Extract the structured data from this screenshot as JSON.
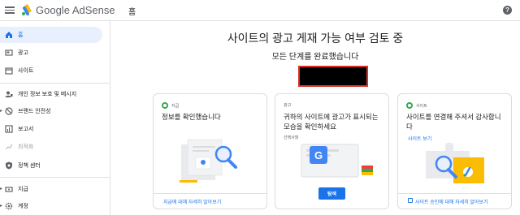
{
  "header": {
    "brand_google": "Google",
    "brand_product": "AdSense",
    "page_title": "홈",
    "help": "?"
  },
  "sidebar": {
    "items": [
      {
        "label": "홈",
        "icon": "home-icon"
      },
      {
        "label": "광고",
        "icon": "ads-icon"
      },
      {
        "label": "사이트",
        "icon": "sites-icon"
      },
      {
        "label": "개인 정보 보호 및 메시지",
        "icon": "privacy-icon"
      },
      {
        "label": "브랜드 안전성",
        "icon": "brand-safety-icon"
      },
      {
        "label": "보고서",
        "icon": "reports-icon"
      },
      {
        "label": "최적화",
        "icon": "optimization-icon"
      },
      {
        "label": "정책 센터",
        "icon": "policy-icon"
      },
      {
        "label": "지급",
        "icon": "payments-icon"
      },
      {
        "label": "계정",
        "icon": "account-icon"
      }
    ]
  },
  "main": {
    "title": "사이트의 광고 게재 가능 여부 검토 중",
    "subtitle": "모든 단계를 완료했습니다"
  },
  "cards": [
    {
      "badge": "지급",
      "title": "정보를 확인했습니다",
      "link": "지급에 대해 자세히 알아보기"
    },
    {
      "badge": "광고",
      "title": "귀하의 사이트에 광고가 표시되는\n모습을 확인하세요",
      "note": "선택사항",
      "button": "탐색"
    },
    {
      "badge": "사이트",
      "title": "사이트를 연결해 주셔서 감사합니\n다",
      "link_top": "사이트 보기",
      "link": "사이트 승인에 대해 자세히 알아보기"
    }
  ],
  "colors": {
    "accent": "#1a73e8",
    "success": "#34a853",
    "warning": "#fbbc04",
    "alert": "#d93025"
  }
}
